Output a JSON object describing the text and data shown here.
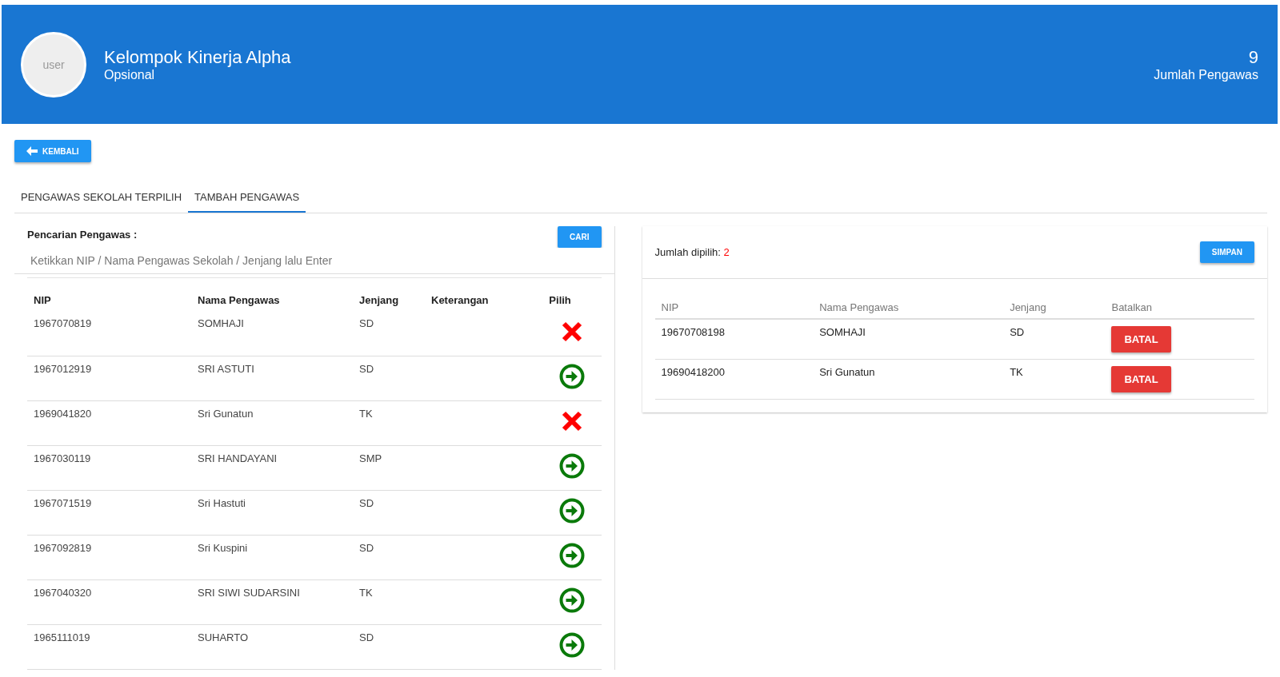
{
  "header": {
    "avatar_alt": "user",
    "title": "Kelompok Kinerja Alpha",
    "subtitle": "Opsional",
    "count": "9",
    "count_label": "Jumlah Pengawas"
  },
  "back_button": "KEMBALI",
  "tabs": [
    {
      "label": "PENGAWAS SEKOLAH TERPILIH",
      "selected": false
    },
    {
      "label": "TAMBAH PENGAWAS",
      "selected": true
    }
  ],
  "search": {
    "label": "Pencarian Pengawas :",
    "button": "CARI",
    "placeholder": "Ketikkan NIP / Nama Pengawas Sekolah / Jenjang lalu Enter"
  },
  "search_table": {
    "columns": [
      "NIP",
      "Nama Pengawas",
      "Jenjang",
      "Keterangan",
      "Pilih"
    ],
    "rows": [
      {
        "nip": "1967070819",
        "name": "SOMHAJI",
        "level": "SD",
        "selected": true
      },
      {
        "nip": "1967012919",
        "name": "SRI ASTUTI",
        "level": "SD",
        "selected": false
      },
      {
        "nip": "1969041820",
        "name": "Sri Gunatun",
        "level": "TK",
        "selected": true
      },
      {
        "nip": "1967030119",
        "name": "SRI HANDAYANI",
        "level": "SMP",
        "selected": false
      },
      {
        "nip": "1967071519",
        "name": "Sri Hastuti",
        "level": "SD",
        "selected": false
      },
      {
        "nip": "1967092819",
        "name": "Sri Kuspini",
        "level": "SD",
        "selected": false
      },
      {
        "nip": "1967040320",
        "name": "SRI SIWI SUDARSINI",
        "level": "TK",
        "selected": false
      },
      {
        "nip": "1965111019",
        "name": "SUHARTO",
        "level": "SD",
        "selected": false
      }
    ]
  },
  "selection": {
    "label": "Jumlah dipilih:",
    "count": "2",
    "button": "SIMPAN"
  },
  "selected_table": {
    "columns": [
      "NIP",
      "Nama Pengawas",
      "Jenjang",
      "Batalkan"
    ],
    "rows": [
      {
        "nip": "19670708198",
        "name": "SOMHAJI",
        "level": "SD",
        "action": "BATAL"
      },
      {
        "nip": "19690418200",
        "name": "Sri Gunatun",
        "level": "TK",
        "action": "BATAL"
      }
    ]
  }
}
